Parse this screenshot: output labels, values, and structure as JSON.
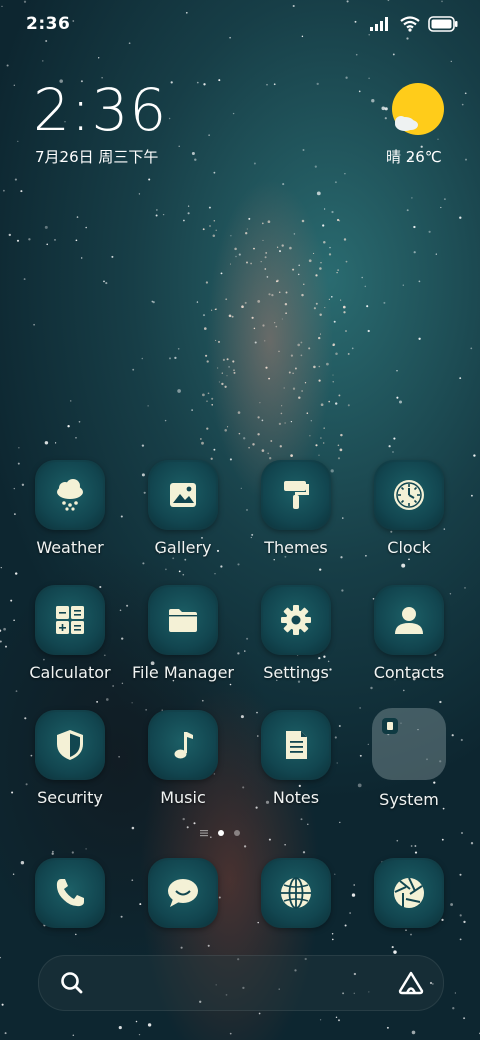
{
  "status_bar": {
    "time": "2:36"
  },
  "widget": {
    "clock": "2:36",
    "date": "7月26日 周三下午",
    "weather": "晴 26℃",
    "weather_icon": "sunny-with-cloud-icon"
  },
  "apps": [
    {
      "label": "Weather",
      "icon": "weather-icon"
    },
    {
      "label": "Gallery",
      "icon": "gallery-icon"
    },
    {
      "label": "Themes",
      "icon": "themes-icon"
    },
    {
      "label": "Clock",
      "icon": "clock-icon"
    },
    {
      "label": "Calculator",
      "icon": "calculator-icon"
    },
    {
      "label": "File Manager",
      "icon": "folder-icon"
    },
    {
      "label": "Settings",
      "icon": "gear-icon"
    },
    {
      "label": "Contacts",
      "icon": "contacts-icon"
    },
    {
      "label": "Security",
      "icon": "shield-icon"
    },
    {
      "label": "Music",
      "icon": "music-note-icon"
    },
    {
      "label": "Notes",
      "icon": "notes-icon"
    },
    {
      "label": "System",
      "icon": "folder-group-icon"
    }
  ],
  "dock": [
    {
      "icon": "phone-icon"
    },
    {
      "icon": "messages-icon"
    },
    {
      "icon": "browser-globe-icon"
    },
    {
      "icon": "camera-aperture-icon"
    }
  ],
  "pager": {
    "pages": 2,
    "current": 1
  },
  "search_bar": {
    "left_icon": "search-icon",
    "right_icon": "assistant-icon"
  },
  "colors": {
    "accent": "#ffcc1a",
    "tile": "#124650",
    "icon_fill": "#f4f1d6"
  }
}
